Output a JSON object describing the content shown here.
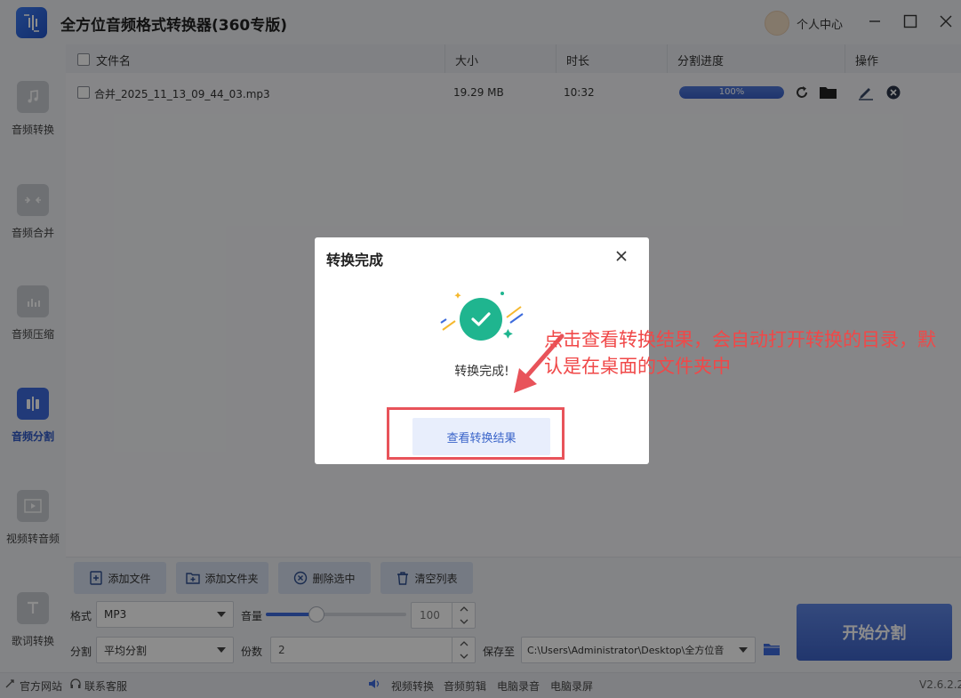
{
  "app": {
    "title": "全方位音频格式转换器(360专版)",
    "user_center": "个人中心"
  },
  "sidebar": {
    "items": [
      {
        "label": "音频转换",
        "icon": "music-note-icon"
      },
      {
        "label": "音频合并",
        "icon": "merge-arrows-icon"
      },
      {
        "label": "音频压缩",
        "icon": "compress-file-icon"
      },
      {
        "label": "音频分割",
        "icon": "split-audio-icon"
      },
      {
        "label": "视频转音频",
        "icon": "video-play-icon"
      },
      {
        "label": "歌词转换",
        "icon": "lyrics-text-icon"
      }
    ],
    "active": "音频分割"
  },
  "table": {
    "headers": {
      "filename": "文件名",
      "size": "大小",
      "duration": "时长",
      "progress": "分割进度",
      "actions": "操作"
    },
    "rows": [
      {
        "filename": "合并_2025_11_13_09_44_03.mp3",
        "size": "19.29 MB",
        "duration": "10:32",
        "progress_value": 100,
        "progress_text": "100%"
      }
    ]
  },
  "toolbar": {
    "add_file": "添加文件",
    "add_folder": "添加文件夹",
    "delete_selected": "删除选中",
    "clear_list": "清空列表"
  },
  "settings": {
    "format_label": "格式",
    "format_value": "MP3",
    "volume_label": "音量",
    "volume_value": "100",
    "volume_fraction": 0.36,
    "split_label": "分割",
    "split_value": "平均分割",
    "parts_label": "份数",
    "parts_value": "2",
    "save_label": "保存至",
    "save_path": "C:\\Users\\Administrator\\Desktop\\全方位音"
  },
  "start_button": "开始分割",
  "statusbar": {
    "website": "官方网站",
    "support": "联系客服",
    "links": [
      "视频转换",
      "音频剪辑",
      "电脑录音",
      "电脑录屏"
    ],
    "version": "V2.6.2.2"
  },
  "dialog": {
    "title": "转换完成",
    "message": "转换完成!",
    "button": "查看转换结果"
  },
  "annotation": {
    "text": "点击查看转换结果，会自动打开转换的目录，默认是在桌面的文件夹中",
    "color": "#f04848"
  },
  "colors": {
    "accent": "#3c6bdc",
    "success": "#1fb58f"
  }
}
